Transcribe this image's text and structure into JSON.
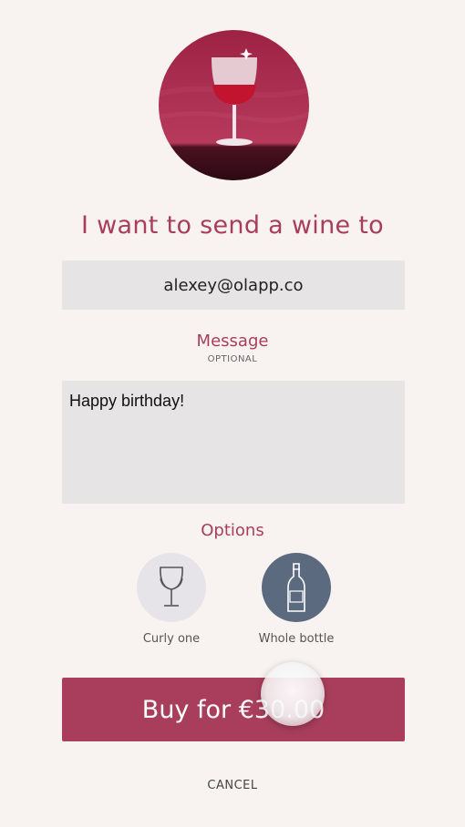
{
  "form": {
    "headline": "I want to send a wine to",
    "recipient_value": "alexey@olapp.co",
    "message_title": "Message",
    "message_subtitle": "OPTIONAL",
    "message_value": "Happy birthday!",
    "options_title": "Options",
    "options": [
      {
        "label": "Curly one",
        "icon": "wine-glass-icon",
        "selected": false
      },
      {
        "label": "Whole bottle",
        "icon": "wine-bottle-icon",
        "selected": true
      }
    ],
    "buy_label": "Buy for €30.00",
    "cancel_label": "CANCEL"
  },
  "colors": {
    "accent": "#a83e5c",
    "background": "#f8f3f0",
    "field": "#e6e4e5",
    "selected_option": "#5b6a7e"
  }
}
